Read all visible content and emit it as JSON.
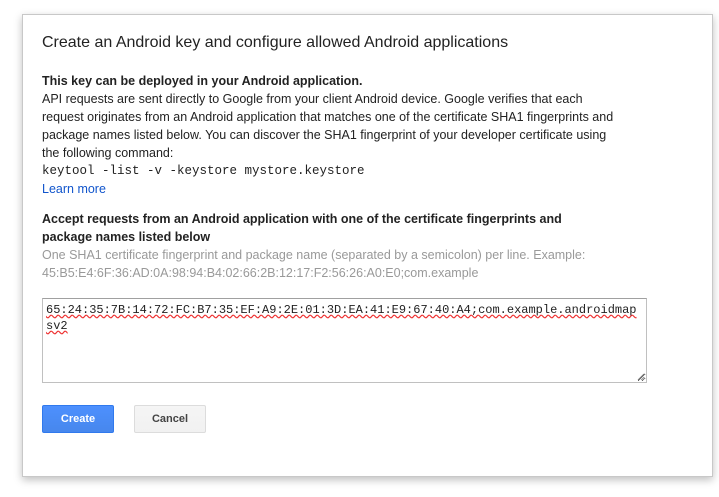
{
  "dialog": {
    "title": "Create an Android key and configure allowed Android applications",
    "section1": {
      "heading": "This key can be deployed in your Android application.",
      "line1": "API requests are sent directly to Google from your client Android device. Google verifies that each",
      "line2": "request originates from an Android application that matches one of the certificate SHA1 fingerprints and",
      "line3": "package names listed below. You can discover the SHA1 fingerprint of your developer certificate using",
      "line4": "the following command:",
      "command": "keytool -list -v -keystore mystore.keystore",
      "learn_more": "Learn more"
    },
    "section2": {
      "heading_line1": "Accept requests from an Android application with one of the certificate fingerprints and",
      "heading_line2": "package names listed below",
      "hint_line1": "One SHA1 certificate fingerprint and package name (separated by a semicolon) per line. Example:",
      "hint_line2": "45:B5:E4:6F:36:AD:0A:98:94:B4:02:66:2B:12:17:F2:56:26:A0:E0;com.example"
    },
    "textarea_value": "65:24:35:7B:14:72:FC:B7:35:EF:A9:2E:01:3D:EA:41:E9:67:40:A4;com.example.androidmapsv2",
    "buttons": {
      "create": "Create",
      "cancel": "Cancel"
    }
  },
  "colors": {
    "primary_button": "#4d90fe",
    "link": "#1155cc",
    "hint": "#999999"
  }
}
